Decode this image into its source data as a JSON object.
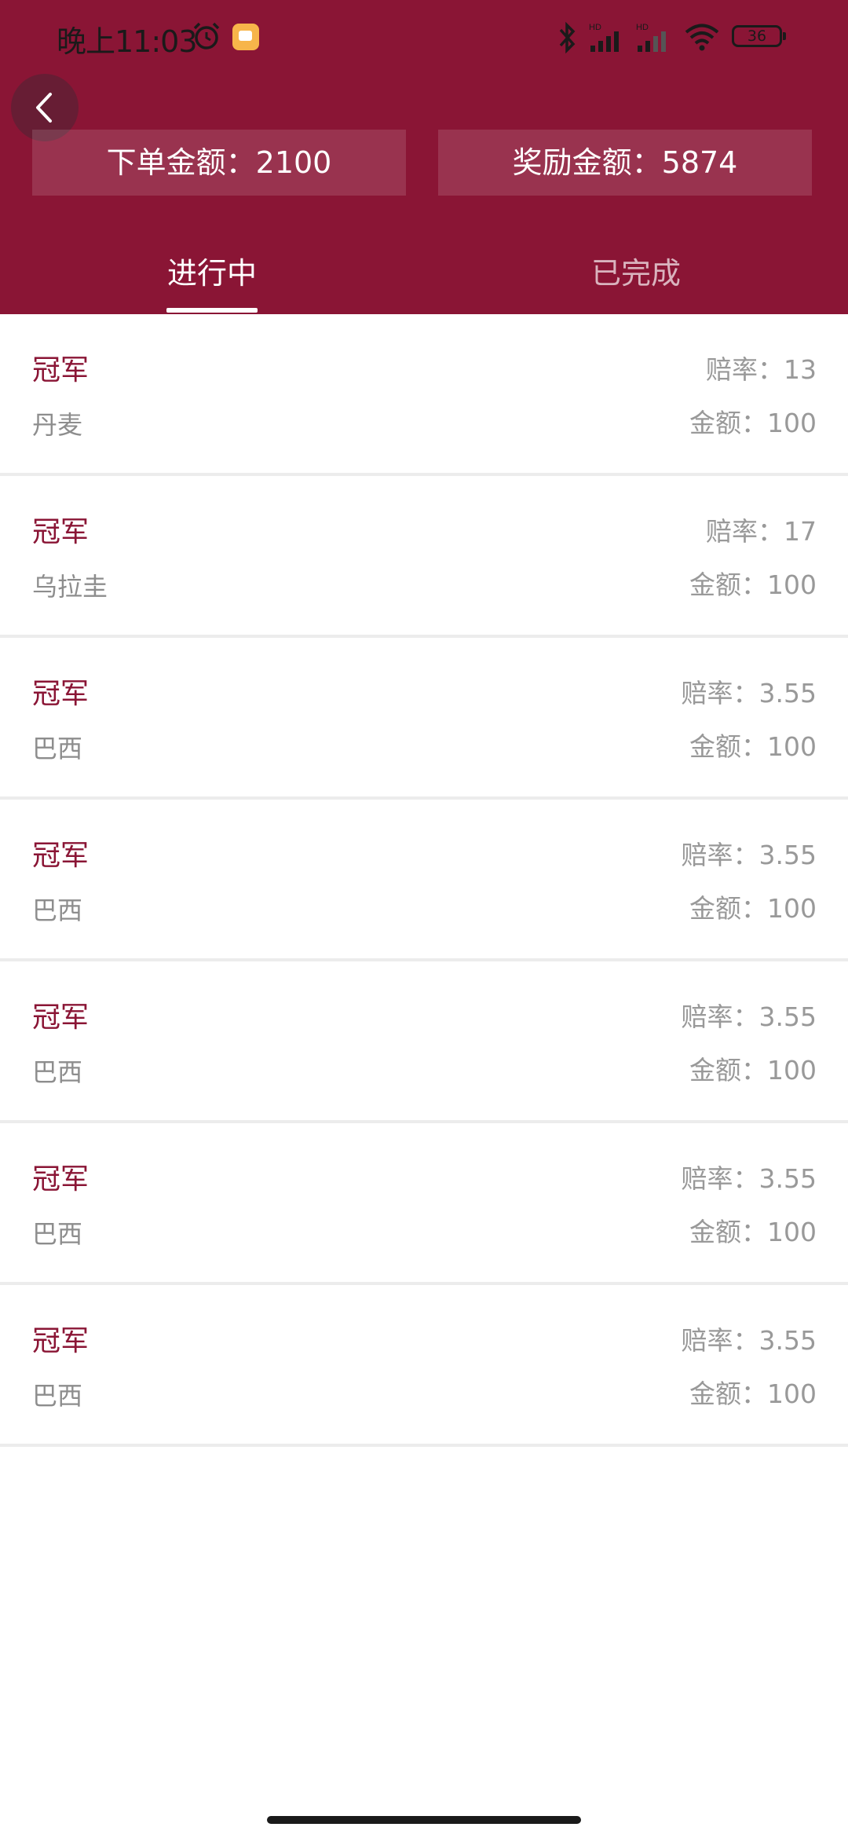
{
  "status_bar": {
    "time": "晚上11:03",
    "battery": "36"
  },
  "summary": {
    "order_amount": "下单金额：2100",
    "reward_amount": "奖励金额：5874"
  },
  "tabs": [
    {
      "label": "进行中"
    },
    {
      "label": "已完成"
    }
  ],
  "orders": [
    {
      "title": "冠军",
      "team": "丹麦",
      "odds": "赔率：13",
      "amount": "金额：100"
    },
    {
      "title": "冠军",
      "team": "乌拉圭",
      "odds": "赔率：17",
      "amount": "金额：100"
    },
    {
      "title": "冠军",
      "team": "巴西",
      "odds": "赔率：3.55",
      "amount": "金额：100"
    },
    {
      "title": "冠军",
      "team": "巴西",
      "odds": "赔率：3.55",
      "amount": "金额：100"
    },
    {
      "title": "冠军",
      "team": "巴西",
      "odds": "赔率：3.55",
      "amount": "金额：100"
    },
    {
      "title": "冠军",
      "team": "巴西",
      "odds": "赔率：3.55",
      "amount": "金额：100"
    },
    {
      "title": "冠军",
      "team": "巴西",
      "odds": "赔率：3.55",
      "amount": "金额：100"
    }
  ],
  "colors": {
    "brand": "#8a1535",
    "secondary_text": "#999999",
    "divider": "#ececec"
  },
  "icons": [
    "alarm-icon",
    "notification-icon",
    "bluetooth-icon",
    "signal-icon",
    "wifi-icon",
    "battery-icon",
    "back-arrow-icon"
  ]
}
